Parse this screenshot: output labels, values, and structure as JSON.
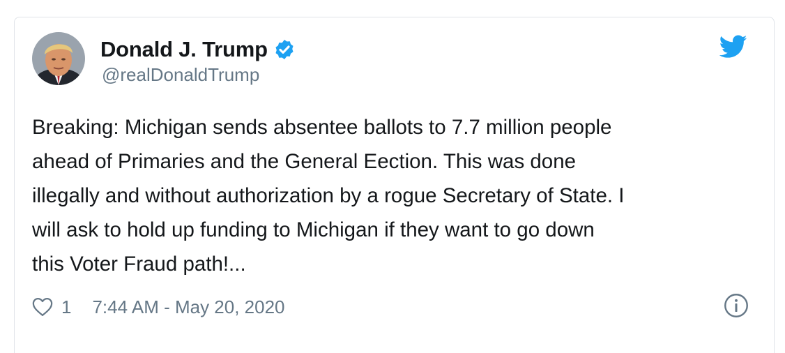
{
  "tweet": {
    "author": {
      "display_name": "Donald J. Trump",
      "handle": "@realDonaldTrump",
      "verified_icon": "verified-badge-icon",
      "avatar_icon": "avatar-photo"
    },
    "platform_icon": "twitter-bird-icon",
    "text_lines": [
      "Breaking: Michigan sends absentee ballots to 7.7 million people",
      "ahead of Primaries and the General Eection. This was done",
      "illegally and without authorization by a rogue Secretary of State. I",
      "will ask to hold up funding to Michigan if they want to go down",
      "this Voter Fraud path!..."
    ],
    "likes": "1",
    "timestamp": "7:44 AM - May 20, 2020",
    "like_icon": "heart-icon",
    "info_icon": "info-icon"
  },
  "colors": {
    "brand_blue": "#1da1f2",
    "text_primary": "#14171a",
    "text_secondary": "#657786",
    "border": "#dfe3e8"
  }
}
